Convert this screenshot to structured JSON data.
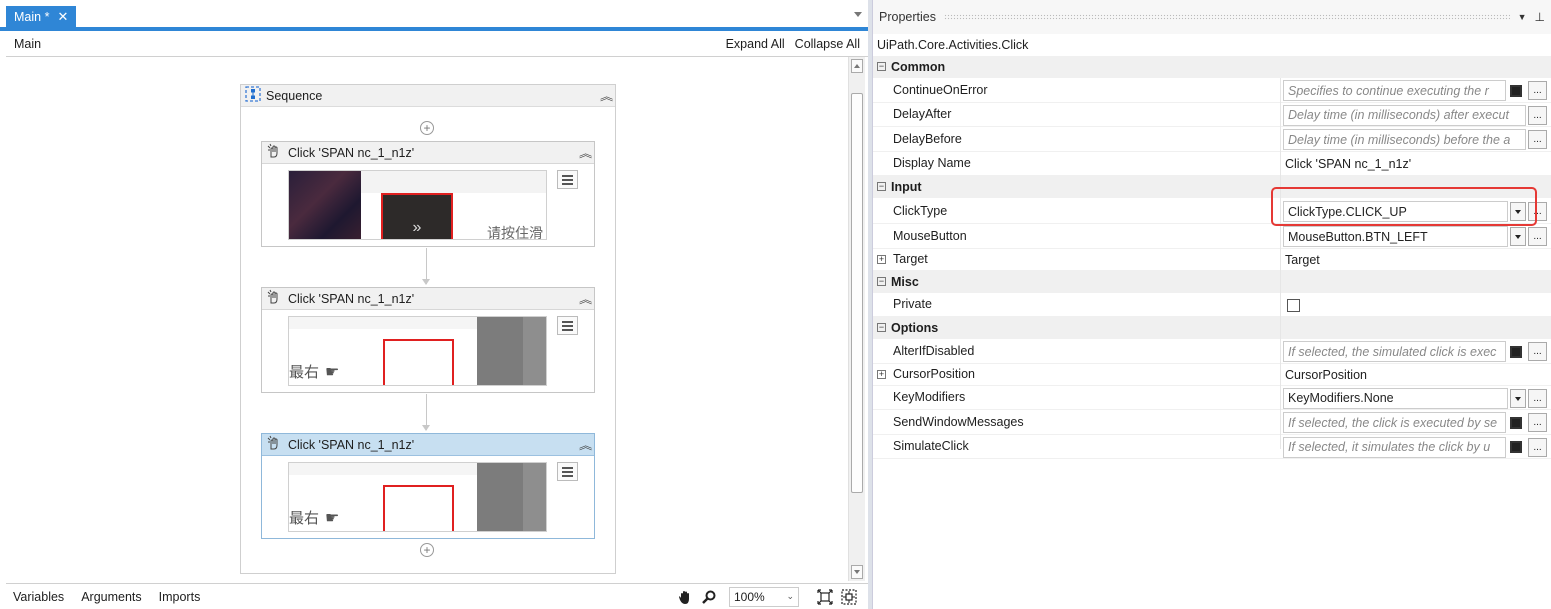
{
  "designer": {
    "tab": {
      "label": "Main *",
      "close": "✕"
    },
    "breadcrumb": "Main",
    "expand_all": "Expand All",
    "collapse_all": "Collapse All",
    "sequence": {
      "title": "Sequence",
      "activities": [
        {
          "title": "Click 'SPAN  nc_1_n1z'",
          "thumb_text": "请按住滑",
          "selected": false
        },
        {
          "title": "Click 'SPAN  nc_1_n1z'",
          "thumb_text": "最右",
          "selected": false
        },
        {
          "title": "Click 'SPAN  nc_1_n1z'",
          "thumb_text": "最右",
          "selected": true
        }
      ]
    },
    "bottom_tabs": {
      "variables": "Variables",
      "arguments": "Arguments",
      "imports": "Imports"
    },
    "zoom": "100%"
  },
  "properties": {
    "title": "Properties",
    "type": "UiPath.Core.Activities.Click",
    "categories": {
      "common": "Common",
      "input": "Input",
      "misc": "Misc",
      "options": "Options"
    },
    "rows": {
      "continue_on_error": {
        "name": "ContinueOnError",
        "placeholder": "Specifies to continue executing the r"
      },
      "delay_after": {
        "name": "DelayAfter",
        "placeholder": "Delay time (in milliseconds) after execut"
      },
      "delay_before": {
        "name": "DelayBefore",
        "placeholder": "Delay time (in milliseconds) before the a"
      },
      "display_name": {
        "name": "Display Name",
        "value": "Click 'SPAN  nc_1_n1z'"
      },
      "click_type": {
        "name": "ClickType",
        "value": "ClickType.CLICK_UP"
      },
      "mouse_button": {
        "name": "MouseButton",
        "value": "MouseButton.BTN_LEFT"
      },
      "target": {
        "name": "Target",
        "value": "Target"
      },
      "private": {
        "name": "Private"
      },
      "alter_if_disabled": {
        "name": "AlterIfDisabled",
        "placeholder": "If selected, the simulated click is exec"
      },
      "cursor_position": {
        "name": "CursorPosition",
        "value": "CursorPosition"
      },
      "key_modifiers": {
        "name": "KeyModifiers",
        "value": "KeyModifiers.None"
      },
      "send_window_messages": {
        "name": "SendWindowMessages",
        "placeholder": "If selected, the click is executed by se"
      },
      "simulate_click": {
        "name": "SimulateClick",
        "placeholder": "If selected, it simulates the click by u"
      }
    },
    "highlight_color": "#e53935",
    "accent_color": "#2f86d6"
  }
}
